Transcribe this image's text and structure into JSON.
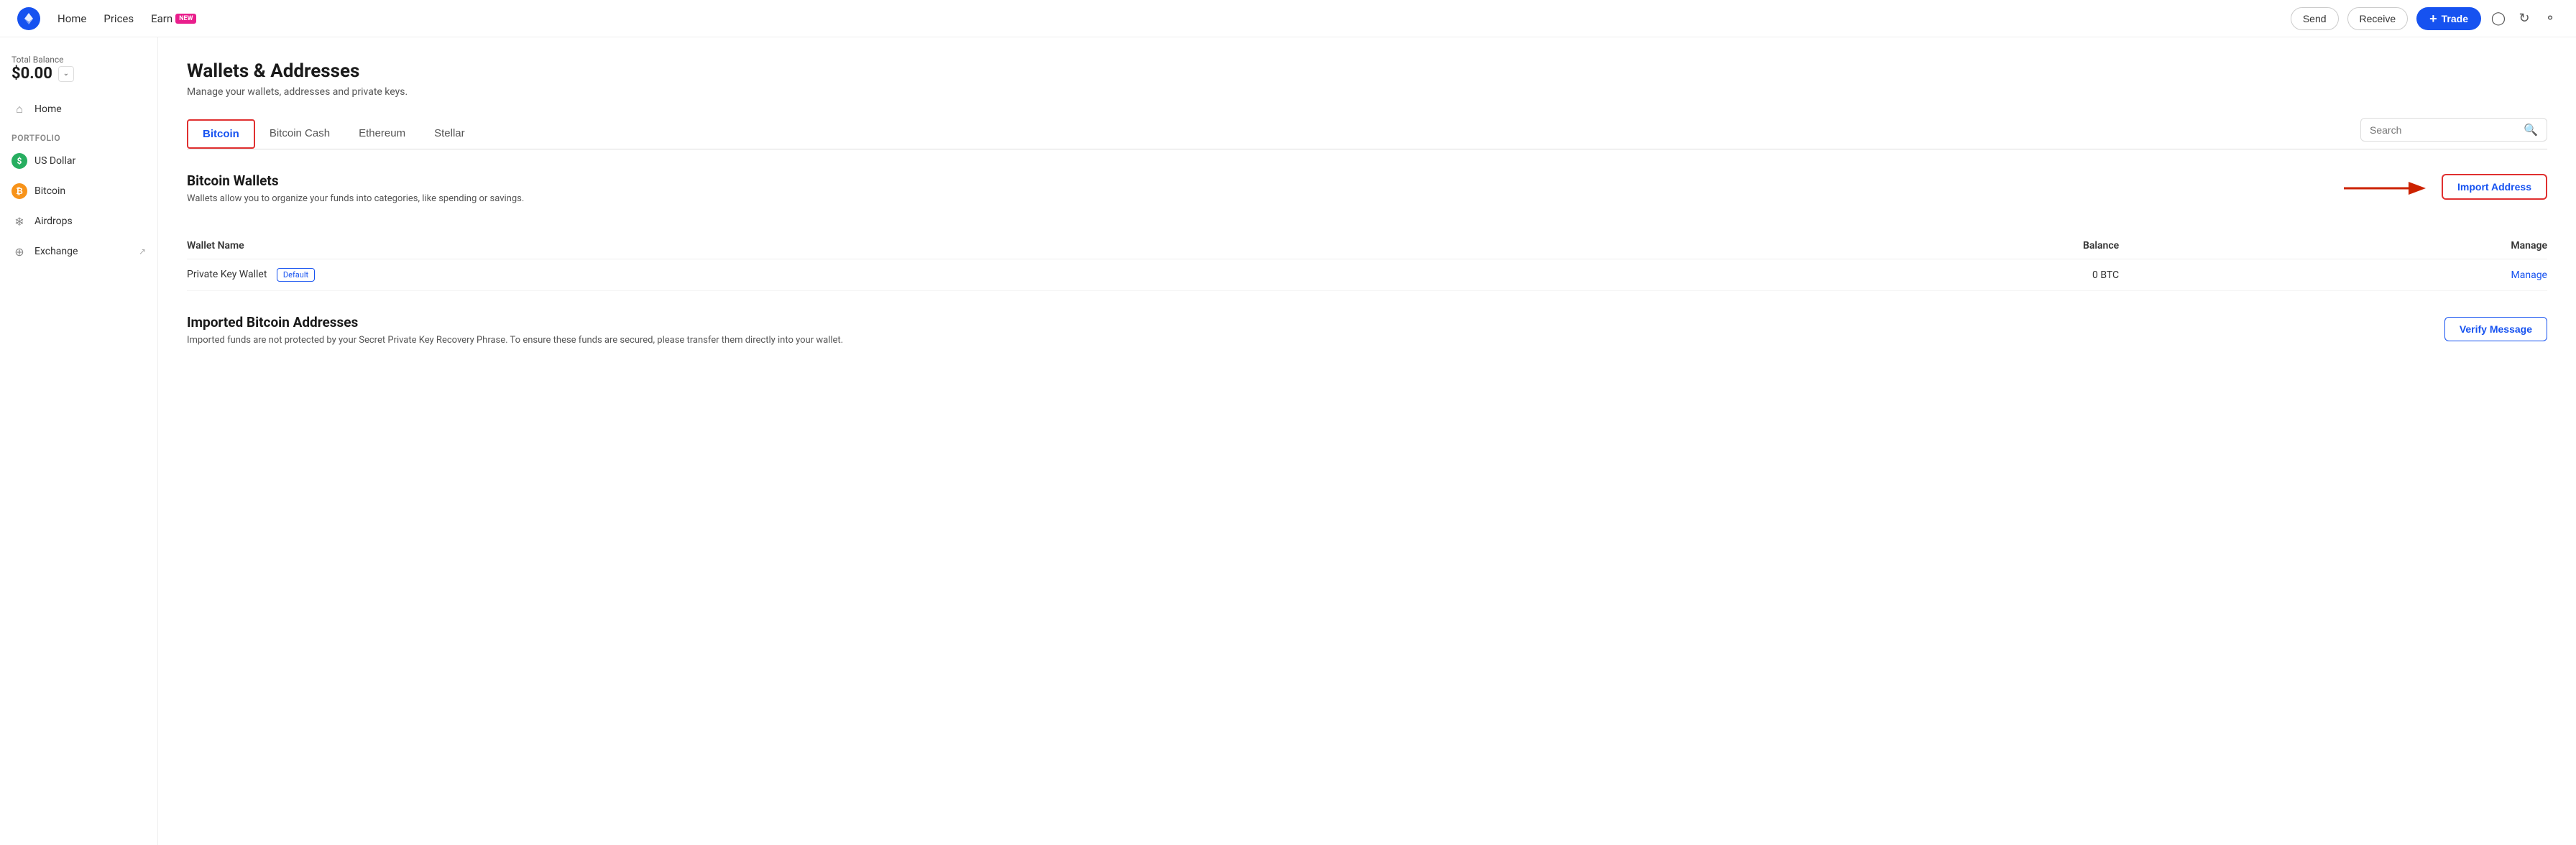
{
  "topnav": {
    "logo_alt": "Coinbase",
    "links": [
      {
        "id": "home",
        "label": "Home"
      },
      {
        "id": "prices",
        "label": "Prices"
      },
      {
        "id": "earn",
        "label": "Earn",
        "badge": "NEW"
      }
    ],
    "send_label": "Send",
    "receive_label": "Receive",
    "trade_label": "Trade",
    "trade_plus": "+"
  },
  "sidebar": {
    "balance_label": "Total Balance",
    "balance_amount": "$0.00",
    "nav": [
      {
        "id": "home",
        "label": "Home",
        "icon": "home"
      },
      {
        "id": "portfolio-label",
        "label": "Portfolio",
        "type": "section"
      },
      {
        "id": "usd",
        "label": "US Dollar",
        "icon": "usd"
      },
      {
        "id": "bitcoin",
        "label": "Bitcoin",
        "icon": "btc"
      },
      {
        "id": "airdrops",
        "label": "Airdrops",
        "icon": "airdrops"
      },
      {
        "id": "exchange",
        "label": "Exchange",
        "icon": "exchange",
        "external": true
      }
    ]
  },
  "main": {
    "page_title": "Wallets & Addresses",
    "page_subtitle": "Manage your wallets, addresses and private keys.",
    "tabs": [
      {
        "id": "bitcoin",
        "label": "Bitcoin",
        "active": true
      },
      {
        "id": "bitcoin-cash",
        "label": "Bitcoin Cash",
        "active": false
      },
      {
        "id": "ethereum",
        "label": "Ethereum",
        "active": false
      },
      {
        "id": "stellar",
        "label": "Stellar",
        "active": false
      }
    ],
    "search": {
      "placeholder": "Search"
    },
    "wallets_section": {
      "title": "Bitcoin Wallets",
      "description": "Wallets allow you to organize your funds into categories, like spending or savings.",
      "import_btn_label": "Import Address",
      "table": {
        "headers": [
          "Wallet Name",
          "Balance",
          "Manage"
        ],
        "rows": [
          {
            "name": "Private Key Wallet",
            "badge": "Default",
            "balance": "0 BTC",
            "manage_label": "Manage"
          }
        ]
      }
    },
    "imported_section": {
      "title": "Imported Bitcoin Addresses",
      "description": "Imported funds are not protected by your Secret Private Key Recovery Phrase. To ensure these funds are secured, please transfer them directly into your wallet.",
      "verify_btn_label": "Verify Message"
    }
  }
}
